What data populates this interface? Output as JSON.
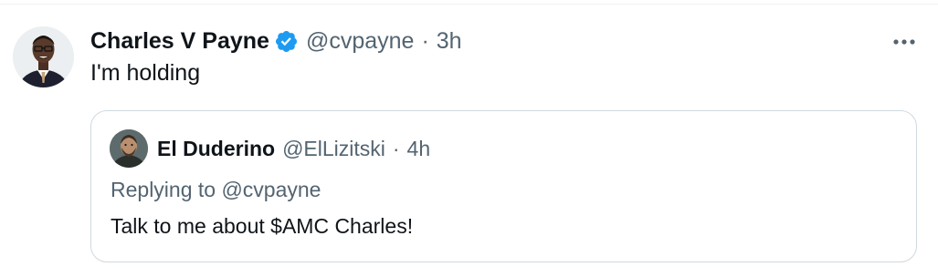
{
  "tweet": {
    "author_name": "Charles V Payne",
    "author_handle": "@cvpayne",
    "separator": "·",
    "time": "3h",
    "text": "I'm holding",
    "verified": true,
    "verified_icon": "verified-badge-icon",
    "more_icon": "more-options-icon",
    "accent_color": "#1d9bf0"
  },
  "quote": {
    "author_name": "El Duderino",
    "author_handle": "@ElLizitski",
    "separator": "·",
    "time": "4h",
    "replying_to": "Replying to @cvpayne",
    "text": "Talk to me about $AMC Charles!"
  },
  "colors": {
    "primary_text": "#0f1419",
    "secondary_text": "#536471",
    "border": "#cfd9de"
  }
}
